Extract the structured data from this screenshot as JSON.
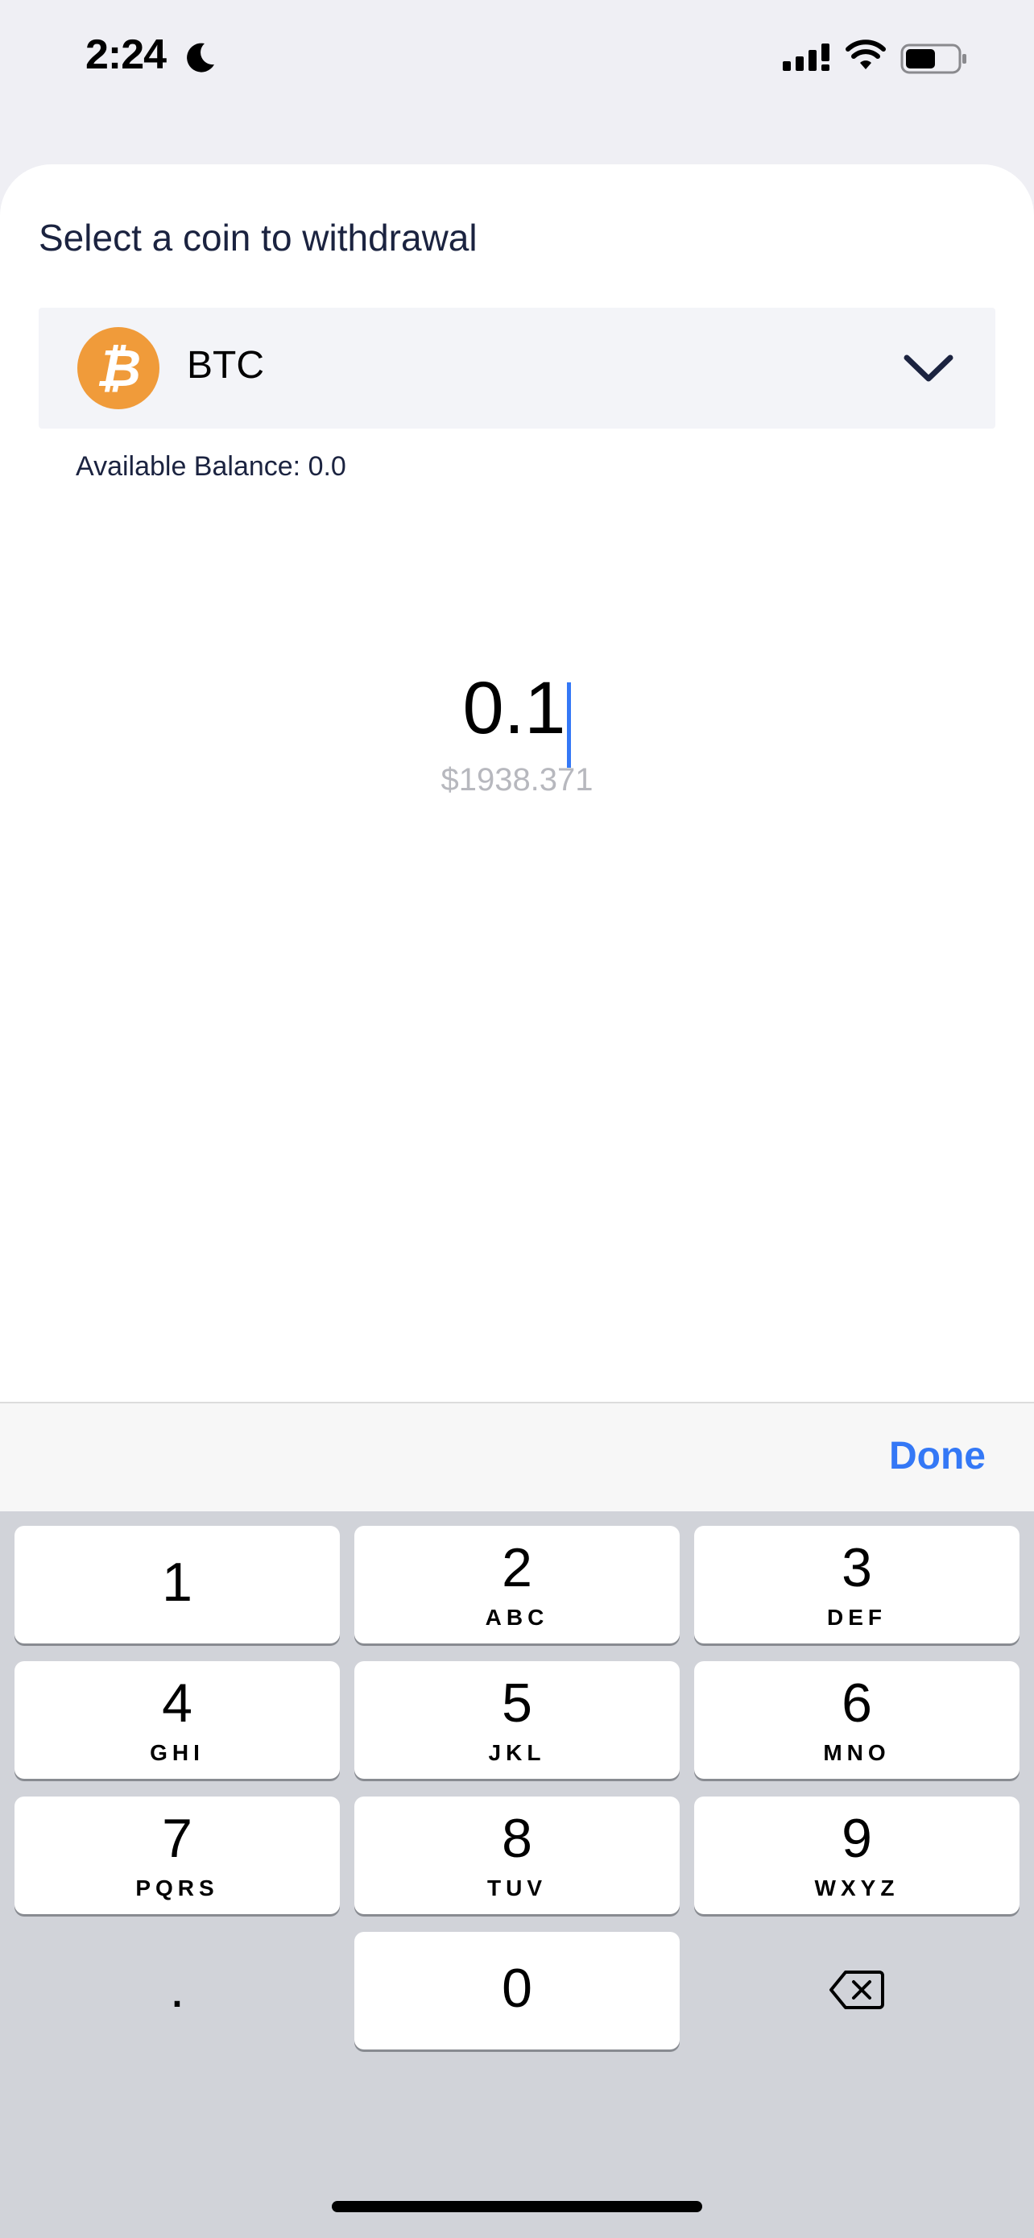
{
  "status_bar": {
    "time": "2:24",
    "moon_icon": "moon-icon",
    "signal_icon": "cellular-signal-icon",
    "wifi_icon": "wifi-icon",
    "battery_icon": "battery-icon"
  },
  "withdraw": {
    "title": "Select a coin to withdrawal",
    "coin": {
      "symbol": "BTC",
      "icon": "bitcoin-icon",
      "icon_glyph": "₿",
      "icon_color": "#f09b3a"
    },
    "dropdown_icon": "chevron-down-icon",
    "available_balance": "Available Balance: 0.0",
    "amount": "0.1",
    "fiat_amount": "$1938.371"
  },
  "accessory": {
    "done_label": "Done"
  },
  "keyboard": {
    "keys": [
      {
        "num": "1",
        "letters": ""
      },
      {
        "num": "2",
        "letters": "ABC"
      },
      {
        "num": "3",
        "letters": "DEF"
      },
      {
        "num": "4",
        "letters": "GHI"
      },
      {
        "num": "5",
        "letters": "JKL"
      },
      {
        "num": "6",
        "letters": "MNO"
      },
      {
        "num": "7",
        "letters": "PQRS"
      },
      {
        "num": "8",
        "letters": "TUV"
      },
      {
        "num": "9",
        "letters": "WXYZ"
      },
      {
        "num": "0",
        "letters": ""
      }
    ],
    "decimal_label": ".",
    "delete_icon": "backspace-icon"
  },
  "colors": {
    "accent": "#3478f6",
    "title_text": "#1b2340",
    "fiat_text": "#b7b8be"
  }
}
